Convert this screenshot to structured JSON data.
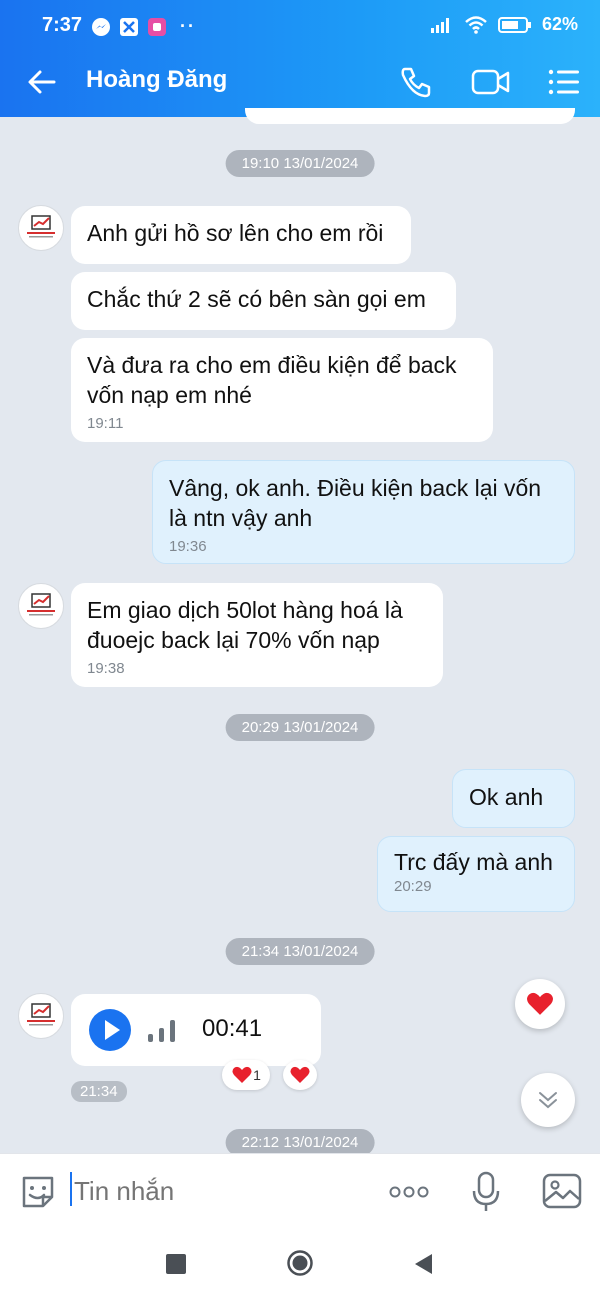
{
  "status_bar": {
    "time": "7:37",
    "battery": "62%",
    "left_icons": [
      "messenger-icon",
      "app-icon",
      "teams-icon",
      "more-dots"
    ],
    "right_icons": [
      "signal-icon",
      "wifi-icon",
      "battery-icon"
    ]
  },
  "header": {
    "title": "Hoàng Đăng",
    "back_icon": "arrow-left-icon",
    "actions": [
      "phone-icon",
      "video-call-icon",
      "menu-list-icon"
    ]
  },
  "messages": {
    "stamp1": "19:10 13/01/2024",
    "m1": "Anh gửi hồ sơ lên cho em rồi",
    "m2": "Chắc thứ 2 sẽ có bên sàn gọi em",
    "m3": "Và đưa ra cho em điều kiện để back vốn nạp em nhé",
    "m3_time": "19:11",
    "m4": "Vâng, ok anh. Điều kiện back lại vốn là ntn vậy anh",
    "m4_time": "19:36",
    "m5": "Em giao dịch 50lot hàng hoá là đuoejc back lại 70% vốn nạp",
    "m5_time": "19:38",
    "stamp2": "20:29 13/01/2024",
    "m6": "Ok anh",
    "m7": "Trc đấy mà anh",
    "m7_time": "20:29",
    "stamp3": "21:34 13/01/2024",
    "voice_duration": "00:41",
    "voice_time": "21:34",
    "reaction_count": "1",
    "stamp4": "22:12 13/01/2024"
  },
  "input": {
    "placeholder": "Tin nhắn"
  },
  "colors": {
    "header_start": "#1a73f0",
    "header_end": "#2bb2fb",
    "chat_bg": "#e3e8ef",
    "outgoing_bubble": "#e0f1fd",
    "incoming_bubble": "#ffffff",
    "accent": "#1a73f0",
    "heart": "#e8212d"
  }
}
